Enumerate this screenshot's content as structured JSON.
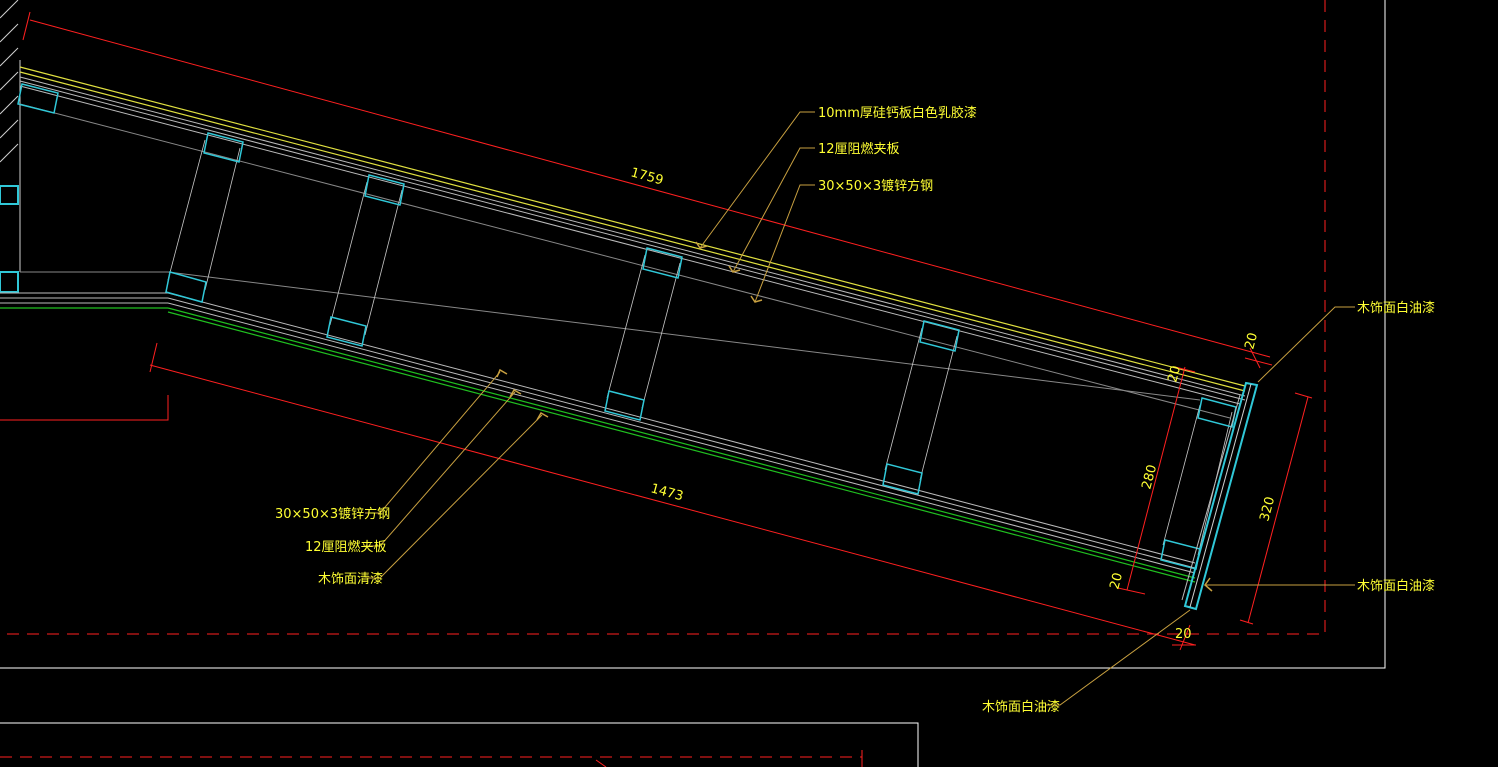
{
  "labels": {
    "top_gypsum": "10mm厚硅钙板白色乳胶漆",
    "top_plywood": "12厘阻燃夹板",
    "top_steel": "30×50×3镀锌方钢",
    "right_top_wood": "木饰面白油漆",
    "right_mid_wood": "木饰面白油漆",
    "bottom_wood": "木饰面白油漆",
    "left_steel": "30×50×3镀锌方钢",
    "left_plywood": "12厘阻燃夹板",
    "left_wood": "木饰面清漆"
  },
  "dimensions": {
    "top_length": "1759",
    "bottom_length": "1473",
    "right_height": "320",
    "inner_height": "280",
    "top_edge": "20",
    "inner_top_edge": "20",
    "inner_bottom_edge": "20",
    "bottom_edge": "20"
  },
  "colors": {
    "dimension_line": "#ff2020",
    "leader_line": "#c8a040",
    "text": "#ffff33",
    "steel_section": "#30c8d8",
    "surface_yellow": "#e0e040",
    "surface_green": "#20c020",
    "frame_line": "#c8c8c8"
  }
}
